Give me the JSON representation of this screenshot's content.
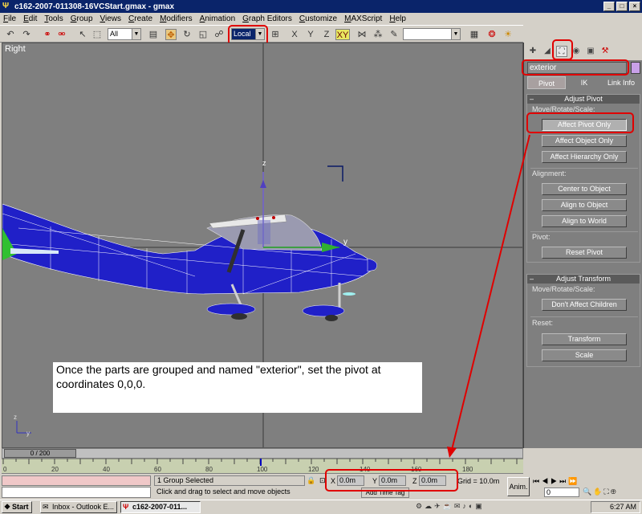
{
  "window": {
    "title": "c162-2007-011308-16VCStart.gmax - gmax",
    "min": "_",
    "max": "□",
    "close": "×"
  },
  "menu": [
    "File",
    "Edit",
    "Tools",
    "Group",
    "Views",
    "Create",
    "Modifiers",
    "Animation",
    "Graph Editors",
    "Customize",
    "MAXScript",
    "Help"
  ],
  "toolbar": {
    "filter_value": "All",
    "coord_system": "Local",
    "icons": [
      "undo-icon",
      "redo-icon",
      "link-icon",
      "unlink-icon",
      "bind-icon",
      "select-icon",
      "region-select-icon",
      "move-icon",
      "rotate-icon",
      "scale-icon",
      "manipulate-icon",
      "constraint-x-icon",
      "constraint-y-icon",
      "constraint-z-icon",
      "constraint-xy-icon",
      "mirror-icon",
      "array-icon",
      "align-icon",
      "named-selection-icon",
      "render-icon",
      "render-quick-icon"
    ],
    "axis_x": "X",
    "axis_y": "Y",
    "axis_z": "Z",
    "axis_xy": "XY"
  },
  "viewport": {
    "label": "Right",
    "axis_z": "z",
    "axis_y": "y",
    "gizmo_z": "z",
    "gizmo_y": "y"
  },
  "caption": {
    "text": "Once the parts are grouped and named \"exterior\", set the pivot at coordinates 0,0,0."
  },
  "command_panel": {
    "object_name": "exterior",
    "object_color": "#c8a0e8",
    "tabs": {
      "pivot": "Pivot",
      "ik": "IK",
      "link_info": "Link Info"
    },
    "adjust_pivot": {
      "title": "Adjust Pivot",
      "move_rotate_scale": "Move/Rotate/Scale:",
      "affect_pivot_only": "Affect Pivot Only",
      "affect_object_only": "Affect Object Only",
      "affect_hierarchy_only": "Affect Hierarchy Only",
      "alignment": "Alignment:",
      "center_to_object": "Center to Object",
      "align_to_object": "Align to Object",
      "align_to_world": "Align to World",
      "pivot": "Pivot:",
      "reset_pivot": "Reset Pivot"
    },
    "adjust_transform": {
      "title": "Adjust Transform",
      "move_rotate_scale": "Move/Rotate/Scale:",
      "dont_affect_children": "Don't Affect Children",
      "reset": "Reset:",
      "transform": "Transform",
      "scale": "Scale"
    }
  },
  "timeline": {
    "slider": "0 / 200",
    "ticks": [
      "0",
      "20",
      "40",
      "60",
      "80",
      "100",
      "120",
      "140",
      "160",
      "180"
    ]
  },
  "status": {
    "selection": "1 Group Selected",
    "prompt": "Click and drag to select and move objects",
    "x_label": "X",
    "x_value": "0.0m",
    "y_label": "Y",
    "y_value": "0.0m",
    "z_label": "Z",
    "z_value": "0.0m",
    "grid": "Grid = 10.0m",
    "add_time_tag": "Add Time Tag",
    "anim": "Anim.",
    "frame_value": "0"
  },
  "taskbar": {
    "start": "Start",
    "items": [
      "Inbox - Outlook E...",
      "c162-2007-011..."
    ],
    "clock": "6:27 AM"
  }
}
